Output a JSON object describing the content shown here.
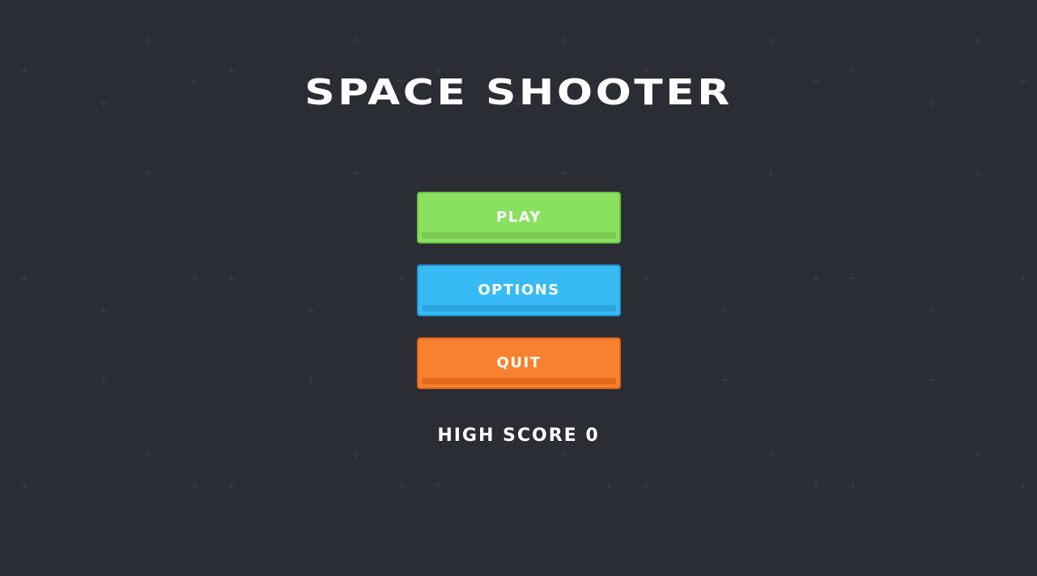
{
  "title": "SPACE SHOOTER",
  "menu": {
    "play": {
      "label": "PLAY",
      "color": "#8ae05f",
      "border": "#6cc142",
      "shade": "#79c84f"
    },
    "options": {
      "label": "OPTIONS",
      "color": "#38bbf4",
      "border": "#1f98d6",
      "shade": "#2aa5e0"
    },
    "quit": {
      "label": "QUIT",
      "color": "#f8812f",
      "border": "#de6417",
      "shade": "#e4691d"
    }
  },
  "high_score": {
    "label": "HIGH SCORE",
    "value": "0"
  },
  "colors": {
    "background": "#2b2d35",
    "star": "#3c3f49",
    "text": "#ffffff"
  }
}
